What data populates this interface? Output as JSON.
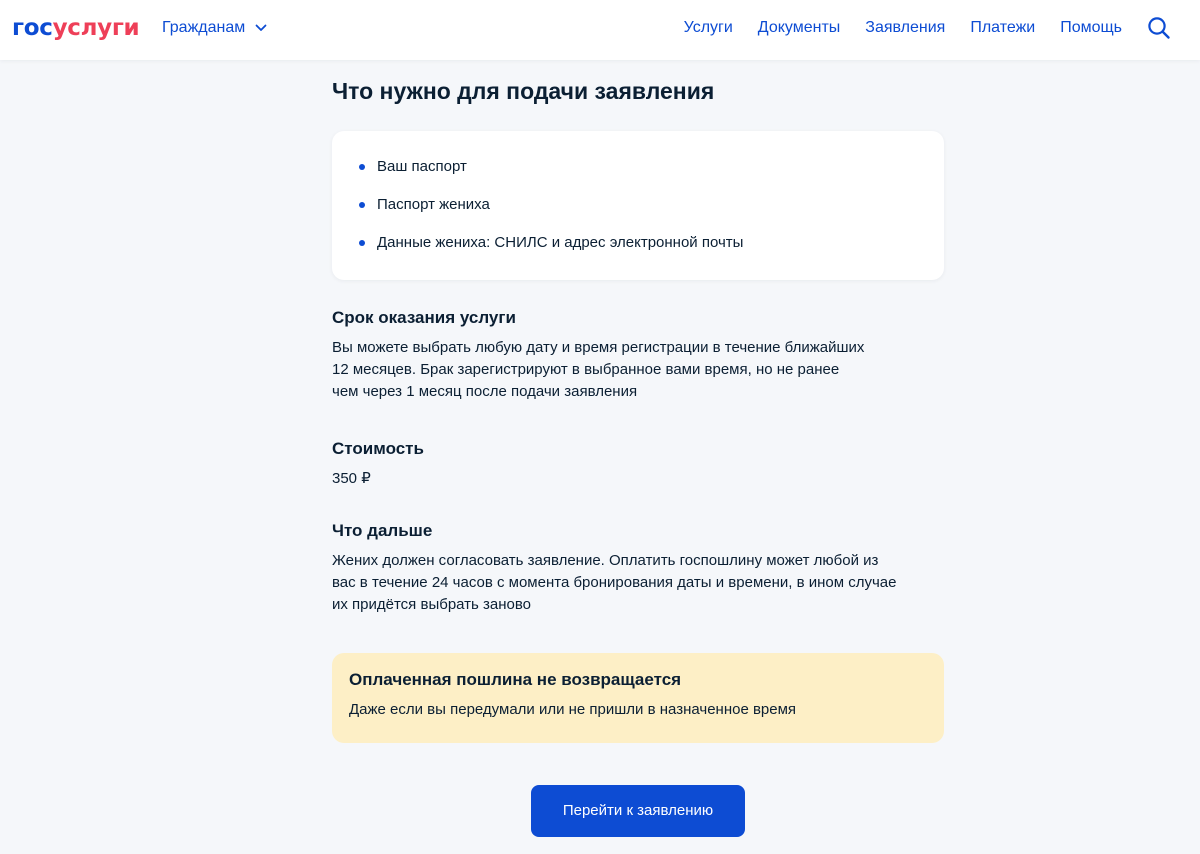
{
  "header": {
    "logo_part1": "гос",
    "logo_part2": "услуги",
    "audience": "Гражданам",
    "nav": [
      "Услуги",
      "Документы",
      "Заявления",
      "Платежи",
      "Помощь"
    ],
    "search_icon": "search-icon"
  },
  "main": {
    "title": "Что нужно для подачи заявления",
    "requirements": [
      "Ваш паспорт",
      "Паспорт жениха",
      "Данные жениха: СНИЛС и адрес электронной почты"
    ],
    "term": {
      "heading": "Срок оказания услуги",
      "lines": [
        "Вы можете выбрать любую дату и время регистрации в течение ближайших",
        "12 месяцев. Брак зарегистрируют в выбранное вами время, но не ранее",
        "чем через 1 месяц после подачи заявления"
      ]
    },
    "cost": {
      "heading": "Стоимость",
      "value": "350 ₽"
    },
    "next": {
      "heading": "Что дальше",
      "lines": [
        "Жених должен согласовать заявление. Оплатить госпошлину может любой из",
        "вас в течение 24 часов с момента бронирования даты и времени, в ином случае",
        "их придётся выбрать заново"
      ]
    },
    "warning": {
      "heading": "Оплаченная пошлина не возвращается",
      "text": "Даже если вы передумали или не пришли в назначенное время"
    },
    "cta_label": "Перейти к заявлению"
  },
  "colors": {
    "brand_blue": "#0d4cd3",
    "brand_red": "#ee3f58",
    "page_bg": "#f5f7fa",
    "warning_bg": "#fdefc6",
    "text": "#0b1f33"
  }
}
